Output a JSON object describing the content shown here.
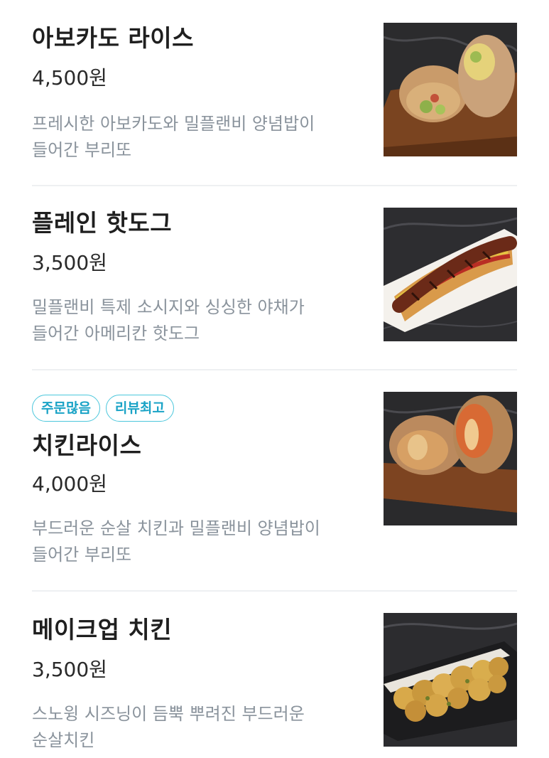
{
  "menu": {
    "items": [
      {
        "name": "아보카도 라이스",
        "price": "4,500원",
        "desc_line1": "프레시한 아보카도와 밀플랜비 양념밥이",
        "desc_line2": "들어간 부리또",
        "image_icon": "burrito-photo",
        "badges": []
      },
      {
        "name": "플레인 핫도그",
        "price": "3,500원",
        "desc_line1": "밀플랜비 특제 소시지와 싱싱한 야채가",
        "desc_line2": "들어간 아메리칸 핫도그",
        "image_icon": "hotdog-photo",
        "badges": []
      },
      {
        "name": "치킨라이스",
        "price": "4,000원",
        "desc_line1": "부드러운 순살 치킨과 밀플랜비 양념밥이",
        "desc_line2": "들어간 부리또",
        "image_icon": "burrito-photo",
        "badges": [
          "주문많음",
          "리뷰최고"
        ]
      },
      {
        "name": "메이크업 치킨",
        "price": "3,500원",
        "desc_line1": "스노윙 시즈닝이 듬뿍 뿌려진 부드러운",
        "desc_line2": "순살치킨",
        "image_icon": "fried-chicken-photo",
        "badges": []
      }
    ]
  },
  "colors": {
    "badge_border": "#4cc7dc",
    "badge_text": "#1aa3c6",
    "desc_text": "#8a939c",
    "divider": "#eef0f2"
  }
}
